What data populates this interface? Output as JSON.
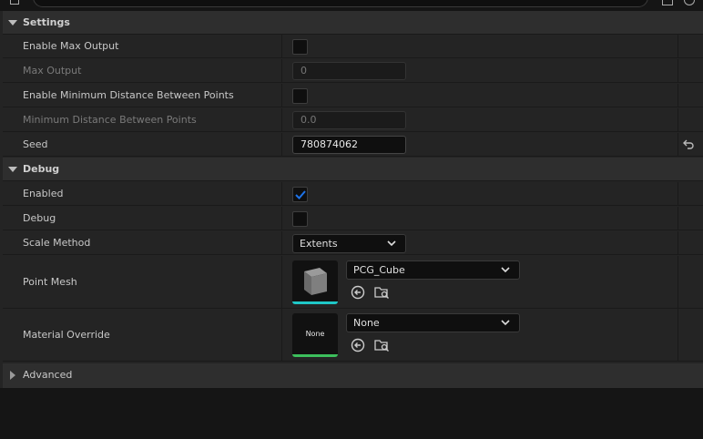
{
  "categories": {
    "settings": "Settings",
    "debug": "Debug",
    "advanced": "Advanced"
  },
  "settings": {
    "enable_max_output": {
      "label": "Enable Max Output",
      "checked": false
    },
    "max_output": {
      "label": "Max Output",
      "value": "0"
    },
    "enable_min_distance": {
      "label": "Enable Minimum Distance Between Points",
      "checked": false
    },
    "min_distance": {
      "label": "Minimum Distance Between Points",
      "value": "0.0"
    },
    "seed": {
      "label": "Seed",
      "value": "780874062"
    }
  },
  "debug": {
    "enabled": {
      "label": "Enabled",
      "checked": true
    },
    "debug": {
      "label": "Debug",
      "checked": false
    },
    "scale_method": {
      "label": "Scale Method",
      "value": "Extents"
    },
    "point_mesh": {
      "label": "Point Mesh",
      "value": "PCG_Cube",
      "thumb_bar_color": "#1fc7c7"
    },
    "material_override": {
      "label": "Material Override",
      "value": "None",
      "thumb_text": "None",
      "thumb_bar_color": "#3cbf5c"
    }
  },
  "colors": {
    "check": "#1e73e8"
  }
}
